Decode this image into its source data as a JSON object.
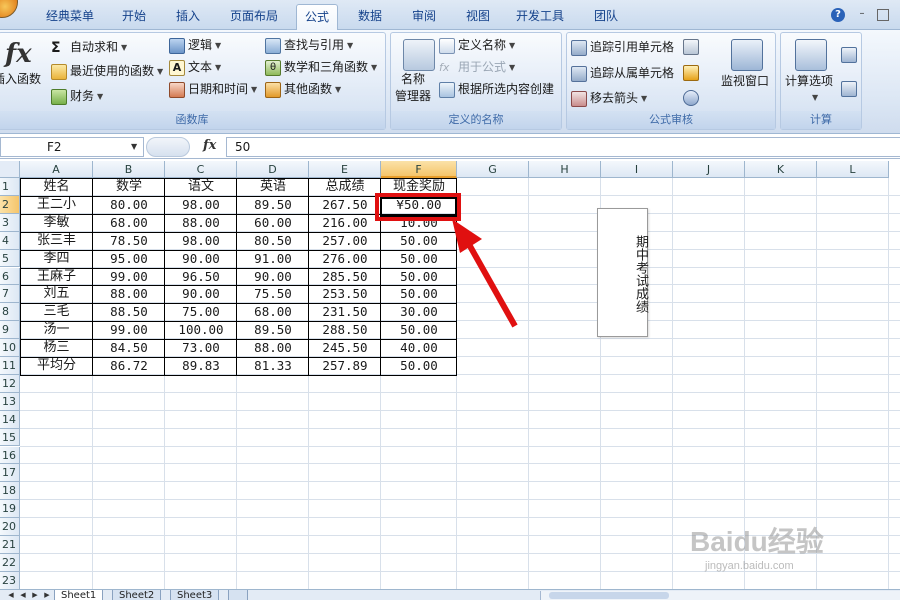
{
  "ribbon_tabs": [
    "经典菜单",
    "开始",
    "插入",
    "页面布局",
    "公式",
    "数据",
    "审阅",
    "视图",
    "开发工具",
    "团队"
  ],
  "active_tab": "公式",
  "groups": {
    "function_library": {
      "title": "函数库",
      "insert_function_label": "插入函数",
      "autosum_label": "自动求和",
      "recent_label": "最近使用的函数",
      "financial_label": "财务",
      "logical_label": "逻辑",
      "text_label": "文本",
      "datetime_label": "日期和时间",
      "lookup_label": "查找与引用",
      "math_label": "数学和三角函数",
      "other_label": "其他函数"
    },
    "defined_names": {
      "title": "定义的名称",
      "name_manager_line1": "名称",
      "name_manager_line2": "管理器",
      "define_name_label": "定义名称",
      "use_in_formula_label": "用于公式",
      "create_from_selection_label": "根据所选内容创建"
    },
    "formula_auditing": {
      "title": "公式审核",
      "trace_precedents_label": "追踪引用单元格",
      "trace_dependents_label": "追踪从属单元格",
      "remove_arrows_label": "移去箭头",
      "watch_window_label": "监视窗口"
    },
    "calculation": {
      "title": "计算",
      "calc_options_label": "计算选项"
    }
  },
  "formula_bar": {
    "name_box": "F2",
    "fx_label": "fx",
    "formula": "50"
  },
  "columns": [
    "A",
    "B",
    "C",
    "D",
    "E",
    "F",
    "G",
    "H",
    "I",
    "J",
    "K",
    "L"
  ],
  "selected_column": "F",
  "selected_row": 2,
  "rows": [
    "1",
    "2",
    "3",
    "4",
    "5",
    "6",
    "7",
    "8",
    "9",
    "10",
    "11",
    "12",
    "13",
    "14",
    "15",
    "16",
    "17",
    "18",
    "19",
    "20",
    "21",
    "22",
    "23"
  ],
  "table": {
    "headers": [
      "姓名",
      "数学",
      "语文",
      "英语",
      "总成绩",
      "现金奖励"
    ],
    "records": [
      [
        "王二小",
        "80.00",
        "98.00",
        "89.50",
        "267.50",
        "¥50.00"
      ],
      [
        "李敏",
        "68.00",
        "88.00",
        "60.00",
        "216.00",
        "10.00"
      ],
      [
        "张三丰",
        "78.50",
        "98.00",
        "80.50",
        "257.00",
        "50.00"
      ],
      [
        "李四",
        "95.00",
        "90.00",
        "91.00",
        "276.00",
        "50.00"
      ],
      [
        "王麻子",
        "99.00",
        "96.50",
        "90.00",
        "285.50",
        "50.00"
      ],
      [
        "刘五",
        "88.00",
        "90.00",
        "75.50",
        "253.50",
        "50.00"
      ],
      [
        "三毛",
        "88.50",
        "75.00",
        "68.00",
        "231.50",
        "30.00"
      ],
      [
        "汤一",
        "99.00",
        "100.00",
        "89.50",
        "288.50",
        "50.00"
      ],
      [
        "杨三",
        "84.50",
        "73.00",
        "88.00",
        "245.50",
        "40.00"
      ],
      [
        "平均分",
        "86.72",
        "89.83",
        "81.33",
        "257.89",
        "50.00"
      ]
    ]
  },
  "textbox": "期中考试成绩",
  "sheet_tabs": [
    "Sheet1",
    "Sheet2",
    "Sheet3"
  ],
  "active_sheet": "Sheet1",
  "watermark": "Baidu经验",
  "watermark_sub": "jingyan.baidu.com",
  "colors": {
    "highlight": "#e01010",
    "selected_header": "#f5c56b"
  }
}
